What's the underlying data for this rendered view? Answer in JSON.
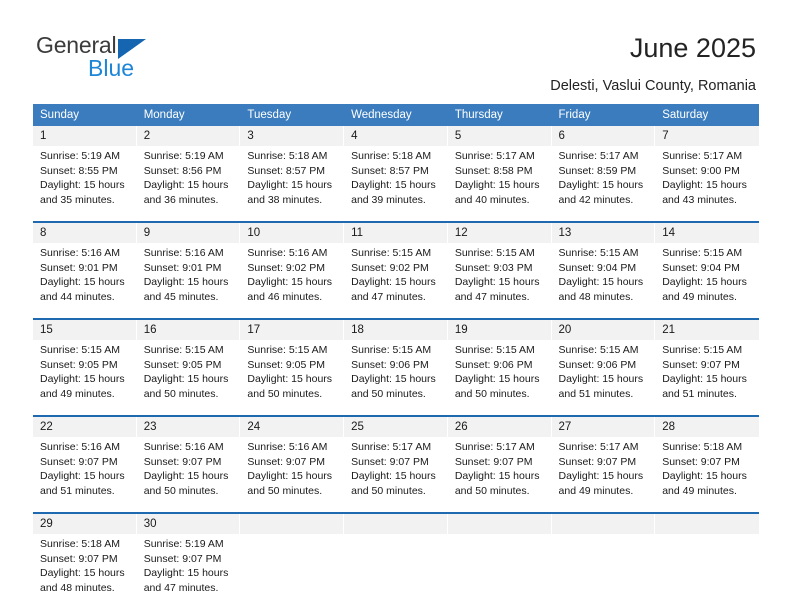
{
  "brand": {
    "name_top": "General",
    "name_bottom": "Blue",
    "accent_blue": "#1d86d6",
    "triangle_blue": "#1565b0"
  },
  "header": {
    "title": "June 2025",
    "subtitle": "Delesti, Vaslui County, Romania"
  },
  "calendar": {
    "header_bg": "#3a7cbe",
    "separator_color": "#1f69b0",
    "daynum_bg": "#f2f2f2",
    "weekdays": [
      "Sunday",
      "Monday",
      "Tuesday",
      "Wednesday",
      "Thursday",
      "Friday",
      "Saturday"
    ],
    "weeks": [
      [
        {
          "day": "1",
          "sunrise": "Sunrise: 5:19 AM",
          "sunset": "Sunset: 8:55 PM",
          "daylight1": "Daylight: 15 hours",
          "daylight2": "and 35 minutes."
        },
        {
          "day": "2",
          "sunrise": "Sunrise: 5:19 AM",
          "sunset": "Sunset: 8:56 PM",
          "daylight1": "Daylight: 15 hours",
          "daylight2": "and 36 minutes."
        },
        {
          "day": "3",
          "sunrise": "Sunrise: 5:18 AM",
          "sunset": "Sunset: 8:57 PM",
          "daylight1": "Daylight: 15 hours",
          "daylight2": "and 38 minutes."
        },
        {
          "day": "4",
          "sunrise": "Sunrise: 5:18 AM",
          "sunset": "Sunset: 8:57 PM",
          "daylight1": "Daylight: 15 hours",
          "daylight2": "and 39 minutes."
        },
        {
          "day": "5",
          "sunrise": "Sunrise: 5:17 AM",
          "sunset": "Sunset: 8:58 PM",
          "daylight1": "Daylight: 15 hours",
          "daylight2": "and 40 minutes."
        },
        {
          "day": "6",
          "sunrise": "Sunrise: 5:17 AM",
          "sunset": "Sunset: 8:59 PM",
          "daylight1": "Daylight: 15 hours",
          "daylight2": "and 42 minutes."
        },
        {
          "day": "7",
          "sunrise": "Sunrise: 5:17 AM",
          "sunset": "Sunset: 9:00 PM",
          "daylight1": "Daylight: 15 hours",
          "daylight2": "and 43 minutes."
        }
      ],
      [
        {
          "day": "8",
          "sunrise": "Sunrise: 5:16 AM",
          "sunset": "Sunset: 9:01 PM",
          "daylight1": "Daylight: 15 hours",
          "daylight2": "and 44 minutes."
        },
        {
          "day": "9",
          "sunrise": "Sunrise: 5:16 AM",
          "sunset": "Sunset: 9:01 PM",
          "daylight1": "Daylight: 15 hours",
          "daylight2": "and 45 minutes."
        },
        {
          "day": "10",
          "sunrise": "Sunrise: 5:16 AM",
          "sunset": "Sunset: 9:02 PM",
          "daylight1": "Daylight: 15 hours",
          "daylight2": "and 46 minutes."
        },
        {
          "day": "11",
          "sunrise": "Sunrise: 5:15 AM",
          "sunset": "Sunset: 9:02 PM",
          "daylight1": "Daylight: 15 hours",
          "daylight2": "and 47 minutes."
        },
        {
          "day": "12",
          "sunrise": "Sunrise: 5:15 AM",
          "sunset": "Sunset: 9:03 PM",
          "daylight1": "Daylight: 15 hours",
          "daylight2": "and 47 minutes."
        },
        {
          "day": "13",
          "sunrise": "Sunrise: 5:15 AM",
          "sunset": "Sunset: 9:04 PM",
          "daylight1": "Daylight: 15 hours",
          "daylight2": "and 48 minutes."
        },
        {
          "day": "14",
          "sunrise": "Sunrise: 5:15 AM",
          "sunset": "Sunset: 9:04 PM",
          "daylight1": "Daylight: 15 hours",
          "daylight2": "and 49 minutes."
        }
      ],
      [
        {
          "day": "15",
          "sunrise": "Sunrise: 5:15 AM",
          "sunset": "Sunset: 9:05 PM",
          "daylight1": "Daylight: 15 hours",
          "daylight2": "and 49 minutes."
        },
        {
          "day": "16",
          "sunrise": "Sunrise: 5:15 AM",
          "sunset": "Sunset: 9:05 PM",
          "daylight1": "Daylight: 15 hours",
          "daylight2": "and 50 minutes."
        },
        {
          "day": "17",
          "sunrise": "Sunrise: 5:15 AM",
          "sunset": "Sunset: 9:05 PM",
          "daylight1": "Daylight: 15 hours",
          "daylight2": "and 50 minutes."
        },
        {
          "day": "18",
          "sunrise": "Sunrise: 5:15 AM",
          "sunset": "Sunset: 9:06 PM",
          "daylight1": "Daylight: 15 hours",
          "daylight2": "and 50 minutes."
        },
        {
          "day": "19",
          "sunrise": "Sunrise: 5:15 AM",
          "sunset": "Sunset: 9:06 PM",
          "daylight1": "Daylight: 15 hours",
          "daylight2": "and 50 minutes."
        },
        {
          "day": "20",
          "sunrise": "Sunrise: 5:15 AM",
          "sunset": "Sunset: 9:06 PM",
          "daylight1": "Daylight: 15 hours",
          "daylight2": "and 51 minutes."
        },
        {
          "day": "21",
          "sunrise": "Sunrise: 5:15 AM",
          "sunset": "Sunset: 9:07 PM",
          "daylight1": "Daylight: 15 hours",
          "daylight2": "and 51 minutes."
        }
      ],
      [
        {
          "day": "22",
          "sunrise": "Sunrise: 5:16 AM",
          "sunset": "Sunset: 9:07 PM",
          "daylight1": "Daylight: 15 hours",
          "daylight2": "and 51 minutes."
        },
        {
          "day": "23",
          "sunrise": "Sunrise: 5:16 AM",
          "sunset": "Sunset: 9:07 PM",
          "daylight1": "Daylight: 15 hours",
          "daylight2": "and 50 minutes."
        },
        {
          "day": "24",
          "sunrise": "Sunrise: 5:16 AM",
          "sunset": "Sunset: 9:07 PM",
          "daylight1": "Daylight: 15 hours",
          "daylight2": "and 50 minutes."
        },
        {
          "day": "25",
          "sunrise": "Sunrise: 5:17 AM",
          "sunset": "Sunset: 9:07 PM",
          "daylight1": "Daylight: 15 hours",
          "daylight2": "and 50 minutes."
        },
        {
          "day": "26",
          "sunrise": "Sunrise: 5:17 AM",
          "sunset": "Sunset: 9:07 PM",
          "daylight1": "Daylight: 15 hours",
          "daylight2": "and 50 minutes."
        },
        {
          "day": "27",
          "sunrise": "Sunrise: 5:17 AM",
          "sunset": "Sunset: 9:07 PM",
          "daylight1": "Daylight: 15 hours",
          "daylight2": "and 49 minutes."
        },
        {
          "day": "28",
          "sunrise": "Sunrise: 5:18 AM",
          "sunset": "Sunset: 9:07 PM",
          "daylight1": "Daylight: 15 hours",
          "daylight2": "and 49 minutes."
        }
      ],
      [
        {
          "day": "29",
          "sunrise": "Sunrise: 5:18 AM",
          "sunset": "Sunset: 9:07 PM",
          "daylight1": "Daylight: 15 hours",
          "daylight2": "and 48 minutes."
        },
        {
          "day": "30",
          "sunrise": "Sunrise: 5:19 AM",
          "sunset": "Sunset: 9:07 PM",
          "daylight1": "Daylight: 15 hours",
          "daylight2": "and 47 minutes."
        },
        {
          "day": "",
          "sunrise": "",
          "sunset": "",
          "daylight1": "",
          "daylight2": ""
        },
        {
          "day": "",
          "sunrise": "",
          "sunset": "",
          "daylight1": "",
          "daylight2": ""
        },
        {
          "day": "",
          "sunrise": "",
          "sunset": "",
          "daylight1": "",
          "daylight2": ""
        },
        {
          "day": "",
          "sunrise": "",
          "sunset": "",
          "daylight1": "",
          "daylight2": ""
        },
        {
          "day": "",
          "sunrise": "",
          "sunset": "",
          "daylight1": "",
          "daylight2": ""
        }
      ]
    ]
  }
}
